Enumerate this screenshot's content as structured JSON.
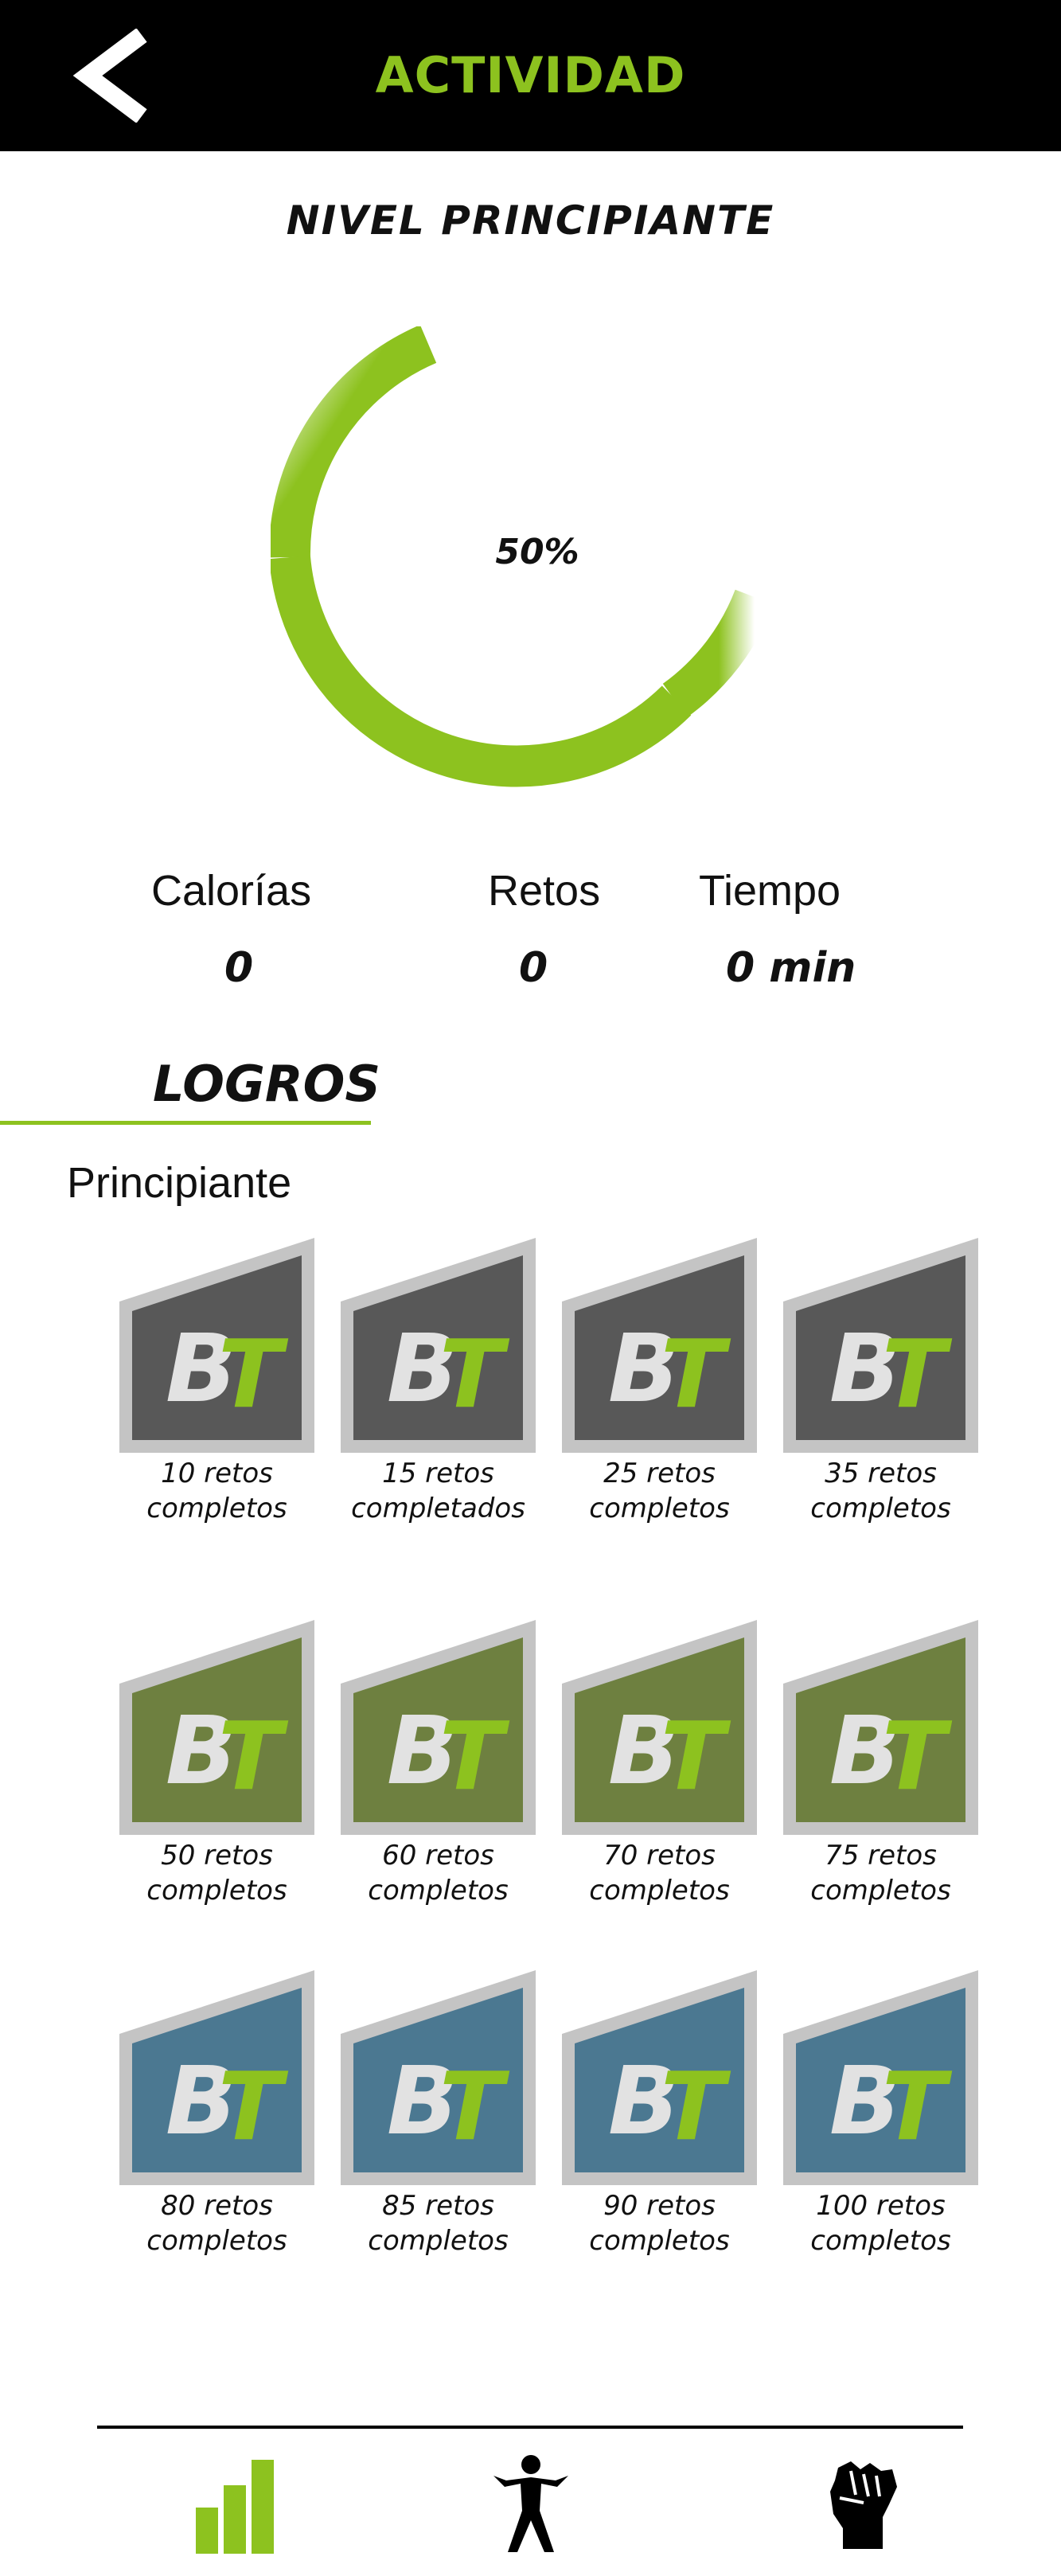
{
  "header": {
    "title": "ACTIVIDAD",
    "back_icon": "chevron-left-icon"
  },
  "level": {
    "title": "NIVEL PRINCIPIANTE",
    "progress_percent": 50,
    "progress_label": "50%"
  },
  "stats": [
    {
      "label": "Calorías",
      "value": "0"
    },
    {
      "label": "Retos",
      "value": "0"
    },
    {
      "label": "Tiempo",
      "value": "0 min"
    }
  ],
  "achievements": {
    "title": "LOGROS",
    "section": "Principiante",
    "badges": [
      {
        "line1": "10 retos",
        "line2": "completos",
        "tier": "gray"
      },
      {
        "line1": "15 retos",
        "line2": "completados",
        "tier": "gray"
      },
      {
        "line1": "25 retos",
        "line2": "completos",
        "tier": "gray"
      },
      {
        "line1": "35 retos",
        "line2": "completos",
        "tier": "gray"
      },
      {
        "line1": "50 retos",
        "line2": "completos",
        "tier": "olive"
      },
      {
        "line1": "60 retos",
        "line2": "completos",
        "tier": "olive"
      },
      {
        "line1": "70 retos",
        "line2": "completos",
        "tier": "olive"
      },
      {
        "line1": "75 retos",
        "line2": "completos",
        "tier": "olive"
      },
      {
        "line1": "80 retos",
        "line2": "completos",
        "tier": "blue"
      },
      {
        "line1": "85 retos",
        "line2": "completos",
        "tier": "blue"
      },
      {
        "line1": "90 retos",
        "line2": "completos",
        "tier": "blue"
      },
      {
        "line1": "100 retos",
        "line2": "completos",
        "tier": "blue"
      }
    ]
  },
  "bottom_nav": [
    {
      "icon": "bar-chart-icon",
      "active": true
    },
    {
      "icon": "person-exercise-icon",
      "active": false
    },
    {
      "icon": "raised-fist-icon",
      "active": false
    }
  ],
  "colors": {
    "accent": "#8dc21f",
    "header_bg": "#000000",
    "badge_frame": "#c4c4c4",
    "tier_gray": "#585858",
    "tier_olive": "#6e8040",
    "tier_blue": "#4b7891",
    "badge_letter_b": "#e2e2e2"
  }
}
